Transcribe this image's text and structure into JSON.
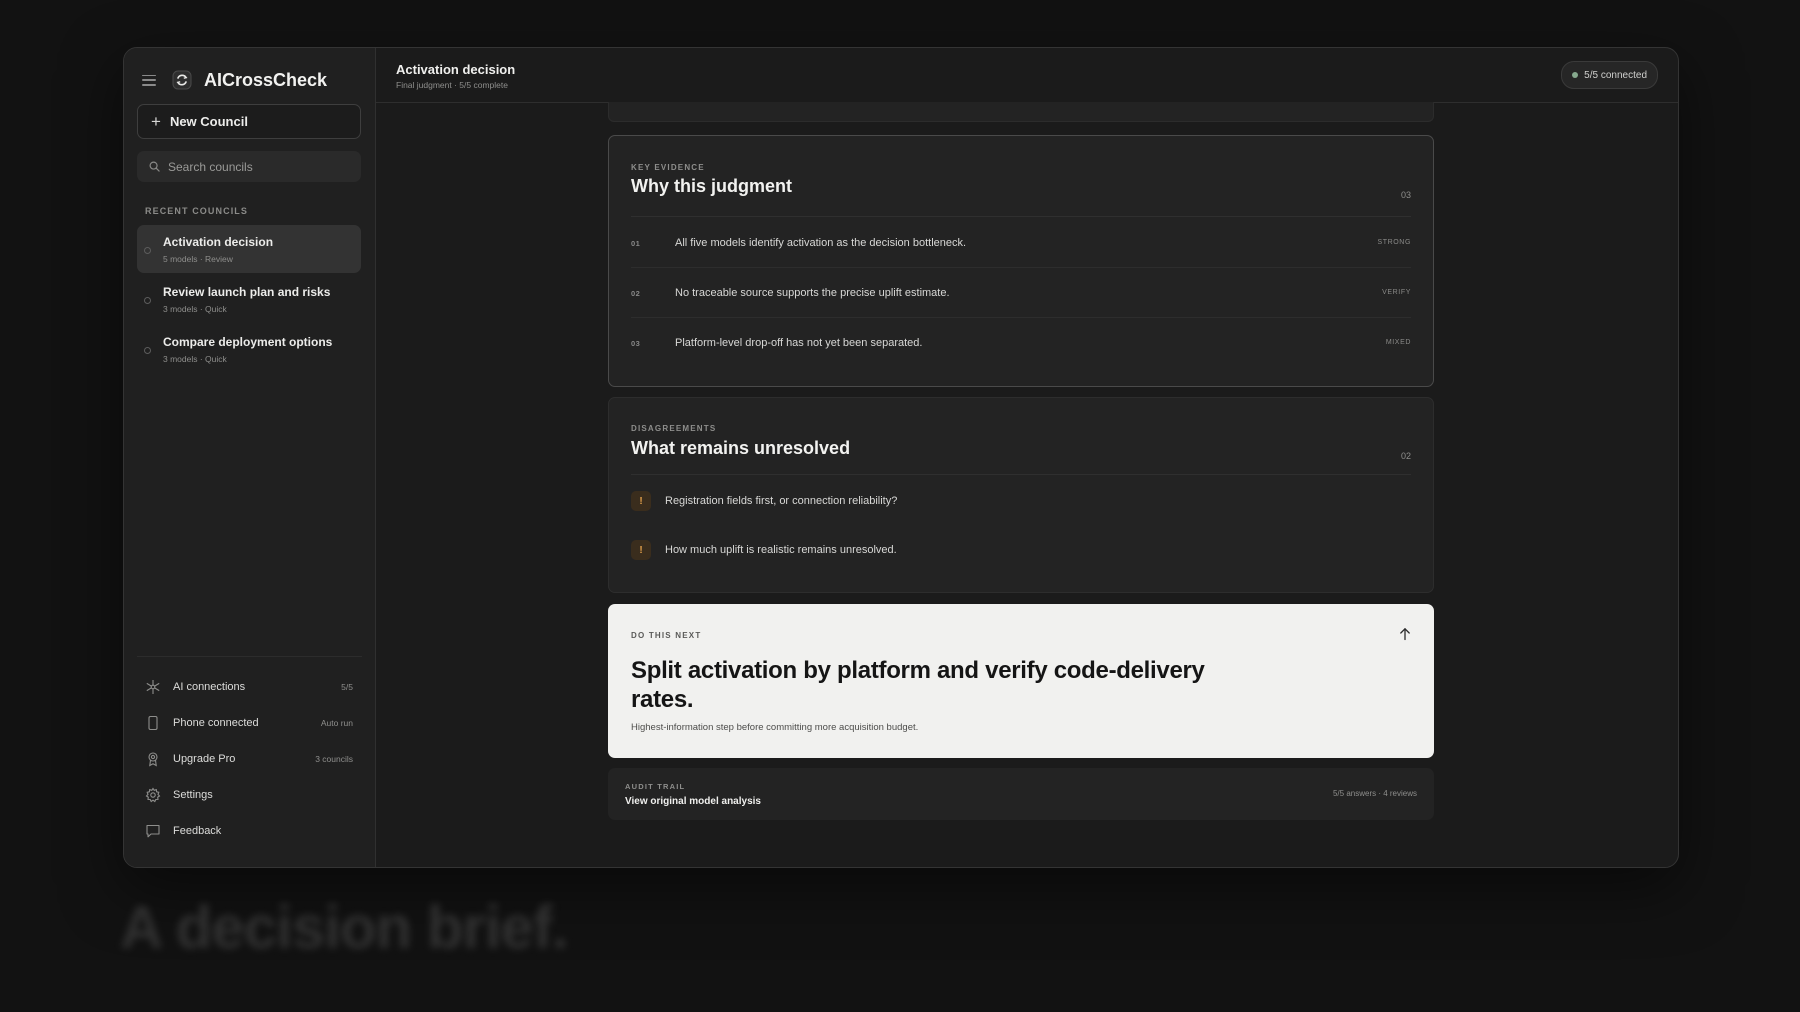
{
  "app": {
    "name": "AICrossCheck",
    "new_council_label": "New Council",
    "search_placeholder": "Search councils"
  },
  "sidebar": {
    "section_label": "RECENT COUNCILS",
    "councils": [
      {
        "title": "Activation decision",
        "meta": "5 models · Review",
        "active": true
      },
      {
        "title": "Review launch plan and risks",
        "meta": "3 models · Quick",
        "active": false
      },
      {
        "title": "Compare deployment options",
        "meta": "3 models · Quick",
        "active": false
      }
    ],
    "bottom_items": [
      {
        "label": "AI connections",
        "meta": "5/5",
        "icon": "network-icon"
      },
      {
        "label": "Phone connected",
        "meta": "Auto run",
        "icon": "phone-icon"
      },
      {
        "label": "Upgrade Pro",
        "meta": "3 councils",
        "icon": "badge-icon"
      },
      {
        "label": "Settings",
        "meta": "",
        "icon": "gear-icon"
      },
      {
        "label": "Feedback",
        "meta": "",
        "icon": "message-icon"
      }
    ]
  },
  "header": {
    "title": "Activation decision",
    "subtitle": "Final judgment · 5/5 complete",
    "connection_status": "5/5 connected",
    "status_color": "#86a98e"
  },
  "evidence": {
    "eyebrow": "KEY EVIDENCE",
    "title": "Why this judgment",
    "count": "03",
    "items": [
      {
        "num": "01",
        "text": "All five models identify activation as the decision bottleneck.",
        "tag": "STRONG"
      },
      {
        "num": "02",
        "text": "No traceable source supports the precise uplift estimate.",
        "tag": "VERIFY"
      },
      {
        "num": "03",
        "text": "Platform-level drop-off has not yet been separated.",
        "tag": "MIXED"
      }
    ]
  },
  "disagreements": {
    "eyebrow": "DISAGREEMENTS",
    "title": "What remains unresolved",
    "count": "02",
    "warning_glyph": "!",
    "warning_color": "#e3a04b",
    "items": [
      {
        "text": "Registration fields first, or connection reliability?"
      },
      {
        "text": "How much uplift is realistic remains unresolved."
      }
    ]
  },
  "next_step": {
    "eyebrow": "DO THIS NEXT",
    "title": "Split activation by platform and verify code-delivery rates.",
    "description": "Highest-information step before committing more acquisition budget."
  },
  "audit": {
    "eyebrow": "AUDIT TRAIL",
    "link_label": "View original model analysis",
    "meta": "5/5 answers · 4 reviews"
  },
  "tagline": "A decision brief."
}
